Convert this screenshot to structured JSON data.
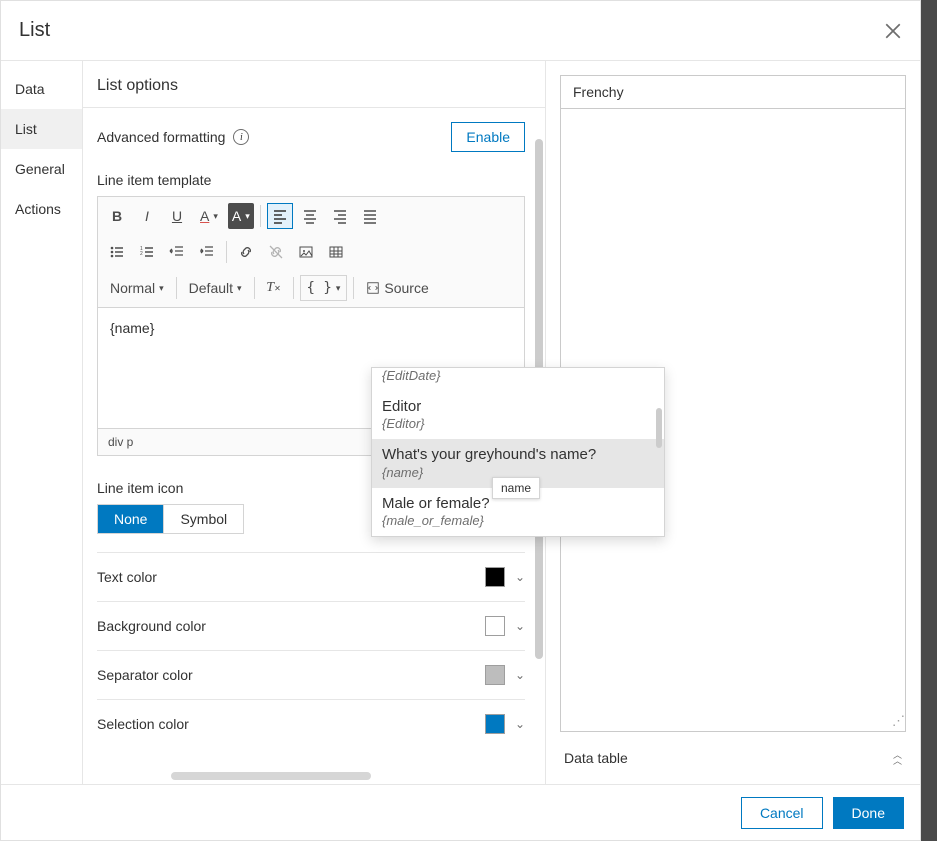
{
  "header": {
    "title": "List"
  },
  "sidebar": {
    "tabs": [
      "Data",
      "List",
      "General",
      "Actions"
    ],
    "active_index": 1
  },
  "options": {
    "title": "List options",
    "advanced_label": "Advanced formatting",
    "enable_label": "Enable",
    "template_label": "Line item template",
    "format_normal": "Normal",
    "format_default": "Default",
    "source_label": "Source",
    "editor_value": "{name}",
    "editor_path": "div   p",
    "icon_label": "Line item icon",
    "icon_none": "None",
    "icon_symbol": "Symbol",
    "colors": {
      "text": {
        "label": "Text color",
        "value": "#000000"
      },
      "background": {
        "label": "Background color",
        "value": "#ffffff"
      },
      "separator": {
        "label": "Separator color",
        "value": "#bdbdbd"
      },
      "selection": {
        "label": "Selection color",
        "value": "#0079c1"
      }
    }
  },
  "field_dropdown": {
    "items": [
      {
        "label": "",
        "token": "{EditDate}",
        "partial": true
      },
      {
        "label": "Editor",
        "token": "{Editor}"
      },
      {
        "label": "What's your greyhound's name?",
        "token": "{name}",
        "hover": true
      },
      {
        "label": "Male or female?",
        "token": "{male_or_female}"
      }
    ],
    "tooltip": "name"
  },
  "preview": {
    "items": [
      "Frenchy"
    ]
  },
  "data_table_label": "Data table",
  "footer": {
    "cancel": "Cancel",
    "done": "Done"
  }
}
